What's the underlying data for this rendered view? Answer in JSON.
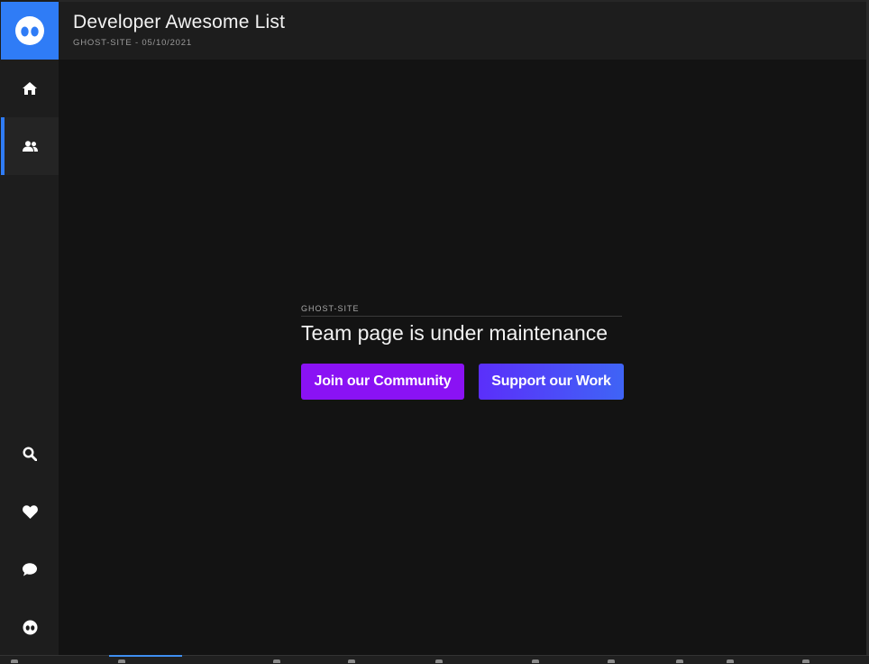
{
  "header": {
    "title": "Developer Awesome List",
    "subtitle": "GHOST-SITE - 05/10/2021"
  },
  "sidebar": {
    "logo_icon": "ghost-face-icon",
    "top_items": [
      {
        "icon": "home-icon",
        "active": false
      },
      {
        "icon": "users-icon",
        "active": true
      }
    ],
    "bottom_items": [
      {
        "icon": "search-icon"
      },
      {
        "icon": "heart-icon"
      },
      {
        "icon": "chat-bubble-icon"
      },
      {
        "icon": "ghost-face-icon"
      }
    ]
  },
  "main": {
    "kicker": "GHOST-SITE",
    "title": "Team page is under maintenance",
    "buttons": {
      "community_label": "Join our Community",
      "support_label": "Support our Work"
    }
  },
  "colors": {
    "accent": "#2f7cf6",
    "community_button": "#8a12f4",
    "support_button_start": "#5b2ffa",
    "support_button_end": "#3f64f6",
    "background": "#141414"
  }
}
